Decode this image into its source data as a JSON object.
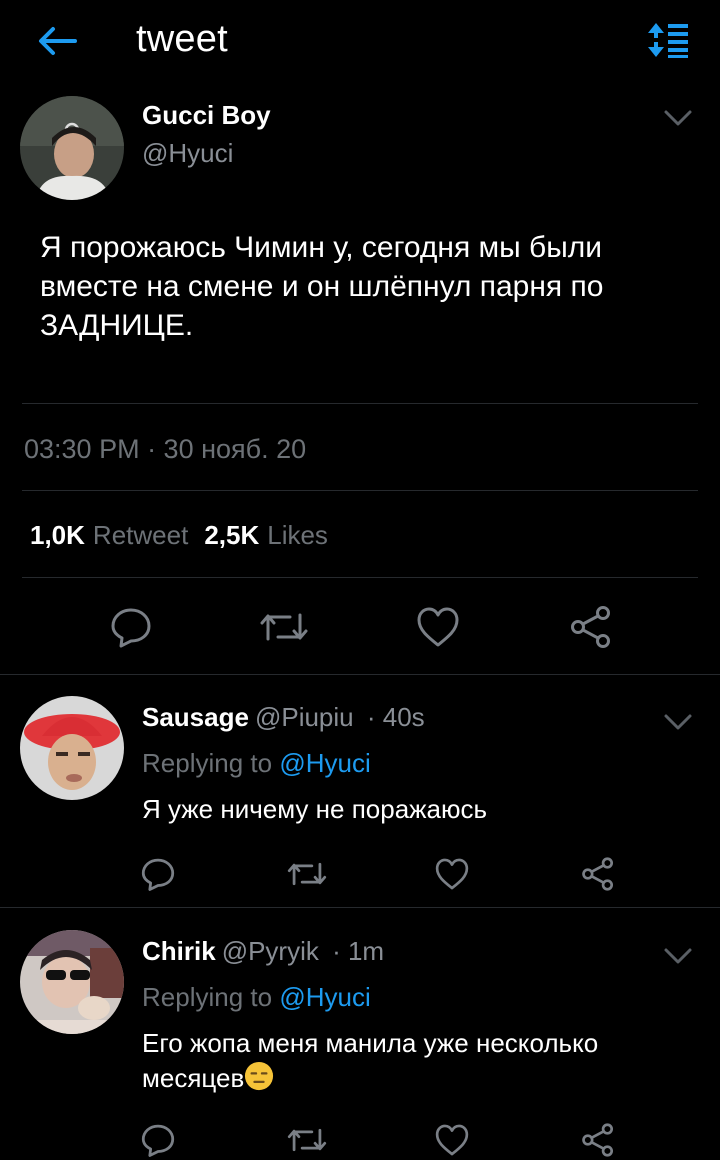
{
  "header": {
    "title": "tweet",
    "back_icon": "arrow-left-icon",
    "sort_icon": "sort-list-icon",
    "accent": "#1d9bf0"
  },
  "main_tweet": {
    "name": "Gucci Boy",
    "handle": "@Hyuci",
    "text": "Я порожаюсь Чимин у, сегодня мы были вместе на смене и он шлёпнул парня по ЗАДНИЦЕ.",
    "timestamp": "03:30 PM · 30 нояб. 20",
    "retweets_count": "1,0K",
    "retweets_label": "Retweet",
    "likes_count": "2,5K",
    "likes_label": "Likes",
    "actions": [
      "reply-icon",
      "retweet-icon",
      "like-icon",
      "share-icon"
    ]
  },
  "replies": [
    {
      "name": "Sausage",
      "handle": "@Piupiu",
      "time": "· 40s",
      "replying_prefix": "Replying to",
      "replying_to": "@Hyuci",
      "text": "Я уже ничему не поражаюсь"
    },
    {
      "name": "Chirik",
      "handle": "@Pyryik",
      "time": "· 1m",
      "replying_prefix": "Replying to",
      "replying_to": "@Hyuci",
      "text": "Его жопа меня манила уже несколько месяцев",
      "emoji": "expressionless-face-emoji"
    }
  ],
  "colors": {
    "background": "#000000",
    "secondary_text": "#6d7277",
    "divider": "#26292d",
    "link": "#1d9bf0"
  }
}
